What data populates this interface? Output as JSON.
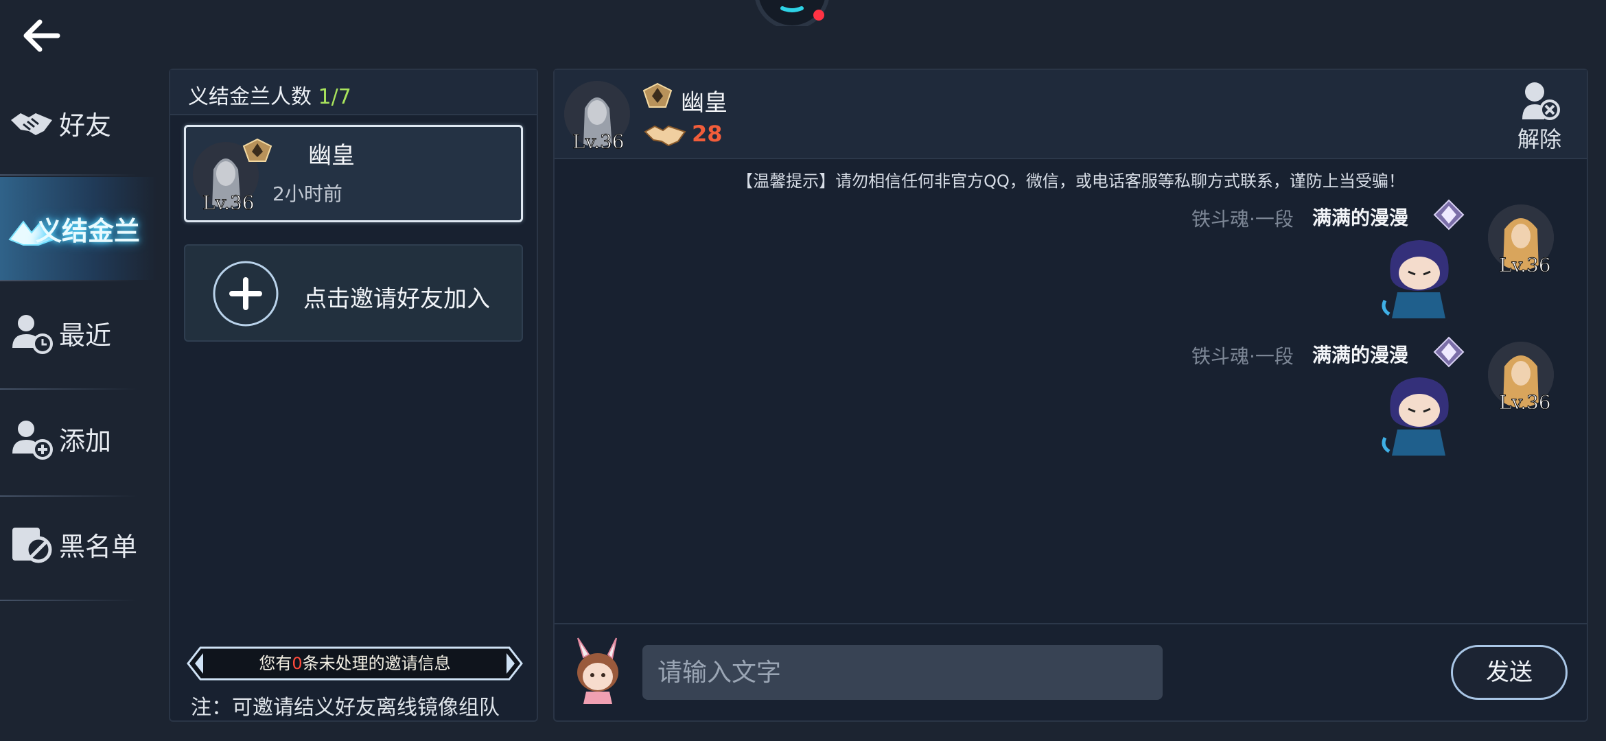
{
  "nav": {
    "items": [
      {
        "label": "好友",
        "icon": "handshake-icon"
      },
      {
        "label": "义结金兰",
        "icon": "brotherhood-hands-icon",
        "active": true
      },
      {
        "label": "最近",
        "icon": "user-clock-icon"
      },
      {
        "label": "添加",
        "icon": "user-add-icon"
      },
      {
        "label": "黑名单",
        "icon": "user-block-icon"
      }
    ]
  },
  "sworn": {
    "title": "义结金兰人数",
    "count": "1/7",
    "friend": {
      "name": "幽皇",
      "time": "2小时前",
      "level": "Lv.36"
    },
    "invite_label": "点击邀请好友加入",
    "pending_prefix": "您有",
    "pending_count": "0",
    "pending_suffix": "条未处理的邀请信息",
    "note": "注：可邀请结义好友离线镜像组队"
  },
  "chat": {
    "header": {
      "name": "幽皇",
      "level": "Lv.36",
      "intimacy": "28",
      "dissolve_label": "解除"
    },
    "warning": "【温馨提示】请勿相信任何非官方QQ，微信，或电话客服等私聊方式联系，谨防上当受骗！",
    "messages": [
      {
        "rank": "铁斗魂·一段",
        "name": "满满的漫漫",
        "level": "Lv.36"
      },
      {
        "rank": "铁斗魂·一段",
        "name": "满满的漫漫",
        "level": "Lv.36"
      }
    ],
    "input_placeholder": "请输入文字",
    "send_label": "发送"
  },
  "colors": {
    "accent_green": "#a8e35c",
    "intimacy_red": "#f25d3a",
    "pending_red": "#ff4a3b",
    "bg": "#1c2431"
  }
}
